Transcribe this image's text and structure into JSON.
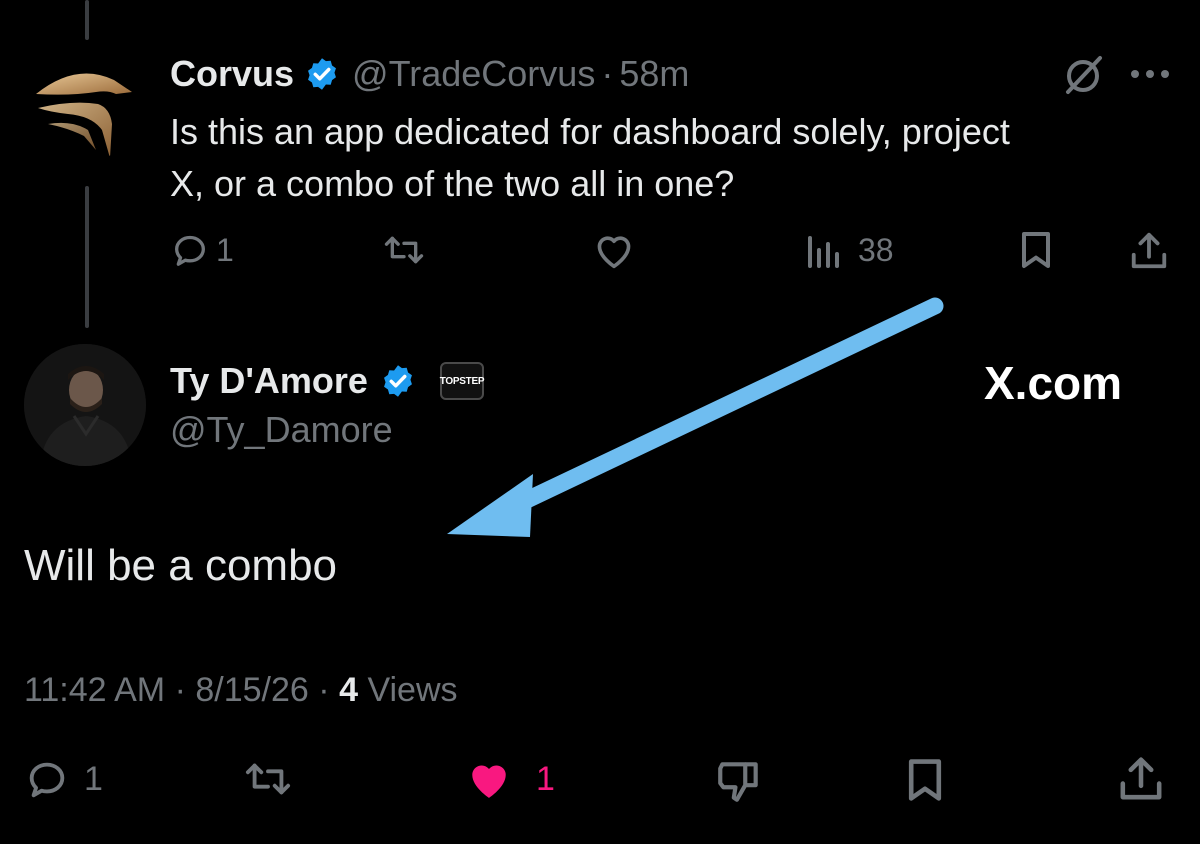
{
  "parent_tweet": {
    "display_name": "Corvus",
    "handle": "@TradeCorvus",
    "separator": "·",
    "time_ago": "58m",
    "text_line1": "Is this an app dedicated for dashboard solely, project",
    "text_line2": "X, or a combo of the two all in one?",
    "replies": "1",
    "views": "38"
  },
  "reply_tweet": {
    "display_name": "Ty D'Amore",
    "handle": "@Ty_Damore",
    "affiliate_badge": "TOPSTEP",
    "text": "Will be a combo",
    "time": "11:42 AM",
    "date": "8/15/26",
    "separator": "·",
    "views_count": "4",
    "views_label": "Views",
    "replies": "1",
    "likes": "1"
  },
  "watermark": "X.com",
  "colors": {
    "background": "#000000",
    "text": "#e7e9ea",
    "muted": "#71767b",
    "verified": "#1d9bf0",
    "like": "#f91880",
    "arrow": "#6fbdf0"
  },
  "icons": [
    "corvus-logo-icon",
    "verified-badge-icon",
    "grok-icon",
    "more-icon",
    "reply-icon",
    "repost-icon",
    "like-icon",
    "views-icon",
    "bookmark-icon",
    "share-icon",
    "dislike-icon",
    "arrow-annotation"
  ]
}
